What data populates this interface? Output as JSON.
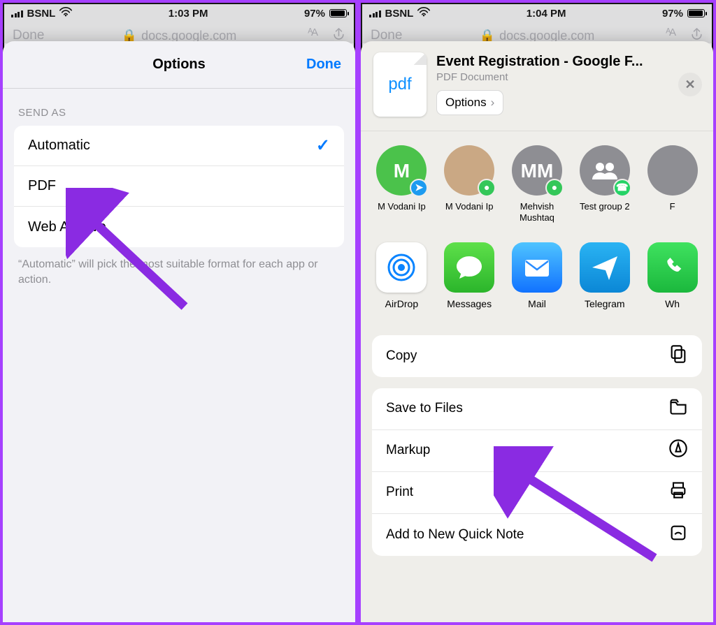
{
  "left": {
    "status": {
      "carrier": "BSNL",
      "time": "1:03 PM",
      "battery": "97%"
    },
    "behind": {
      "done": "Done",
      "url": "docs.google.com",
      "aa": "AA"
    },
    "panel_title": "Options",
    "done": "Done",
    "section": "SEND AS",
    "rows": [
      "Automatic",
      "PDF",
      "Web Archive"
    ],
    "selected": 0,
    "hint": "“Automatic” will pick the most suitable format for each app or action."
  },
  "right": {
    "status": {
      "carrier": "BSNL",
      "time": "1:04 PM",
      "battery": "97%"
    },
    "behind": {
      "done": "Done",
      "url": "docs.google.com",
      "aa": "AA"
    },
    "pdf_badge": "pdf",
    "title": "Event Registration - Google F...",
    "subtitle": "PDF Document",
    "options_btn": "Options",
    "contacts": [
      {
        "name": "M Vodani Ip",
        "avatar_text": "M",
        "avatar_bg": "#4bc24b",
        "badge_bg": "#1d9bf0",
        "badge_glyph": "➤"
      },
      {
        "name": "M Vodani Ip",
        "avatar_text": "",
        "avatar_bg": "#caa884",
        "badge_bg": "#34c759",
        "badge_glyph": "●"
      },
      {
        "name": "Mehvish Mushtaq",
        "avatar_text": "MM",
        "avatar_bg": "#8e8e93",
        "badge_bg": "#34c759",
        "badge_glyph": "●"
      },
      {
        "name": "Test group 2",
        "avatar_text": "",
        "avatar_bg": "#8e8e93",
        "badge_bg": "#25d366",
        "badge_glyph": "☎",
        "group": true
      },
      {
        "name": "F",
        "avatar_text": "",
        "avatar_bg": "#8e8e93"
      }
    ],
    "apps": [
      {
        "name": "AirDrop",
        "bg": "#ffffff",
        "fg": "#0a84ff",
        "glyph": "airdrop",
        "border": true
      },
      {
        "name": "Messages",
        "bg": "linear-gradient(#5ee04a,#2bb52b)",
        "glyph": "bubble"
      },
      {
        "name": "Mail",
        "bg": "linear-gradient(#4fc4ff,#1172ff)",
        "glyph": "mail"
      },
      {
        "name": "Telegram",
        "bg": "linear-gradient(#2ab3f3,#0b87d6)",
        "glyph": "plane"
      },
      {
        "name": "Wh",
        "bg": "linear-gradient(#3fe25f,#1bb83d)",
        "glyph": "phone"
      }
    ],
    "actions1": [
      {
        "label": "Copy",
        "icon": "copy"
      }
    ],
    "actions2": [
      {
        "label": "Save to Files",
        "icon": "folder"
      },
      {
        "label": "Markup",
        "icon": "markup"
      },
      {
        "label": "Print",
        "icon": "print"
      },
      {
        "label": "Add to New Quick Note",
        "icon": "note"
      }
    ]
  }
}
